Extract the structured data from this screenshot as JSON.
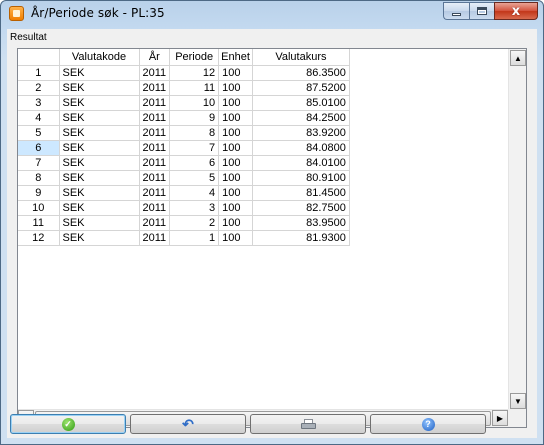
{
  "window": {
    "title": "År/Periode søk - PL:35",
    "close_glyph": "x"
  },
  "group": {
    "label": "Resultat"
  },
  "table": {
    "columns": [
      "",
      "Valutakode",
      "År",
      "Periode",
      "Enhet",
      "Valutakurs"
    ],
    "selected_row": 6,
    "rows": [
      [
        "1",
        "SEK",
        "2011",
        "12",
        "100",
        "86.3500"
      ],
      [
        "2",
        "SEK",
        "2011",
        "11",
        "100",
        "87.5200"
      ],
      [
        "3",
        "SEK",
        "2011",
        "10",
        "100",
        "85.0100"
      ],
      [
        "4",
        "SEK",
        "2011",
        "9",
        "100",
        "84.2500"
      ],
      [
        "5",
        "SEK",
        "2011",
        "8",
        "100",
        "83.9200"
      ],
      [
        "6",
        "SEK",
        "2011",
        "7",
        "100",
        "84.0800"
      ],
      [
        "7",
        "SEK",
        "2011",
        "6",
        "100",
        "84.0100"
      ],
      [
        "8",
        "SEK",
        "2011",
        "5",
        "100",
        "80.9100"
      ],
      [
        "9",
        "SEK",
        "2011",
        "4",
        "100",
        "81.4500"
      ],
      [
        "10",
        "SEK",
        "2011",
        "3",
        "100",
        "82.7500"
      ],
      [
        "11",
        "SEK",
        "2011",
        "2",
        "100",
        "83.9500"
      ],
      [
        "12",
        "SEK",
        "2011",
        "1",
        "100",
        "81.9300"
      ]
    ]
  },
  "buttons": [
    {
      "name": "ok-button",
      "icon": "check-icon"
    },
    {
      "name": "undo-button",
      "icon": "undo-icon"
    },
    {
      "name": "print-button",
      "icon": "printer-icon"
    },
    {
      "name": "help-button",
      "icon": "help-icon"
    }
  ],
  "colors": {
    "selected_row_header": "#cde8ff",
    "title_gradient": "#b9d1ea",
    "close_button": "#c23619"
  }
}
